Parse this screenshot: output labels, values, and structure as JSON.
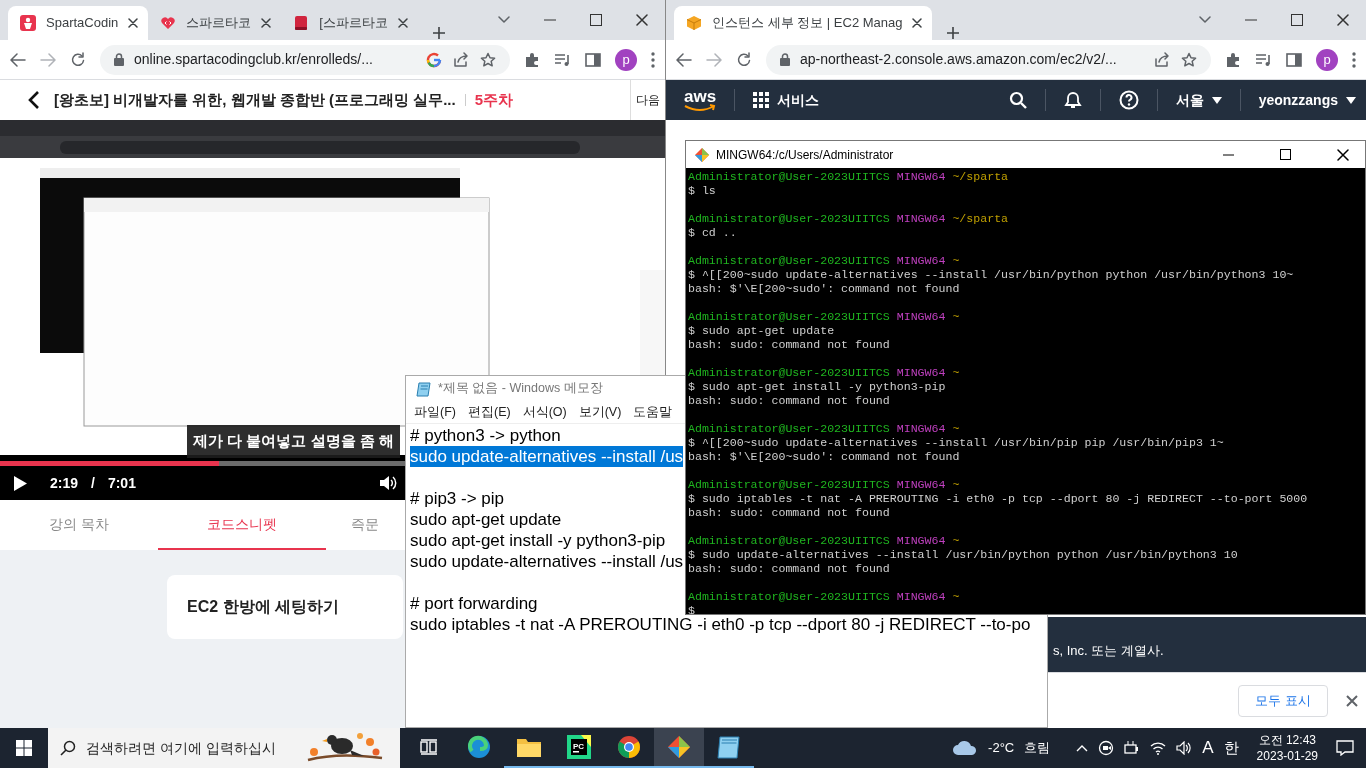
{
  "left_browser": {
    "tabs": [
      {
        "title": "SpartaCodin",
        "selected": true
      },
      {
        "title": "스파르타코",
        "selected": false
      },
      {
        "title": "[스파르타코",
        "selected": false
      }
    ],
    "address": "online.spartacodingclub.kr/enrolleds/...",
    "profile": "p",
    "course_title": "[왕초보] 비개발자를 위한, 웹개발 종합반 (프로그래밍 실무...",
    "week": "5주차",
    "next": "다음",
    "video": {
      "kind": "picture",
      "caption": "제가 다 붙여넣고 설명을 좀 해",
      "level": 0.33,
      "current": "2:19",
      "separator": "/",
      "duration": "7:01"
    },
    "lesson_tabs": [
      {
        "label": "강의 목차",
        "selected": false
      },
      {
        "label": "코드스니펫",
        "selected": true
      },
      {
        "label": "즉문",
        "selected": false
      }
    ],
    "snippet_card": "EC2 한방에 세팅하기"
  },
  "right_browser": {
    "tabs": [
      {
        "title": "인스턴스 세부 정보 | EC2 Manag",
        "selected": true
      }
    ],
    "address": "ap-northeast-2.console.aws.amazon.com/ec2/v2/...",
    "profile": "p",
    "aws_nav": {
      "logo": "aws",
      "services": "서비스",
      "region": "서울",
      "account": "yeonzzangs"
    },
    "footer": "s, Inc. 또는 계열사.",
    "download_bar": {
      "show_all": "모두 표시"
    }
  },
  "terminal": {
    "title": "MINGW64:/c/Users/Administrator",
    "lines": [
      {
        "kind": "prompt",
        "user": "Administrator@User-2023UIITCS",
        "shell": "MINGW64",
        "path": "~/sparta"
      },
      {
        "kind": "input",
        "text": "$ ls"
      },
      {
        "kind": "blank"
      },
      {
        "kind": "prompt",
        "user": "Administrator@User-2023UIITCS",
        "shell": "MINGW64",
        "path": "~/sparta"
      },
      {
        "kind": "input",
        "text": "$ cd .."
      },
      {
        "kind": "blank"
      },
      {
        "kind": "prompt",
        "user": "Administrator@User-2023UIITCS",
        "shell": "MINGW64",
        "path": "~"
      },
      {
        "kind": "input",
        "text": "$ ^[[200~sudo update-alternatives --install /usr/bin/python python /usr/bin/python3 10~"
      },
      {
        "kind": "output",
        "text": "bash: $'\\E[200~sudo': command not found"
      },
      {
        "kind": "blank"
      },
      {
        "kind": "prompt",
        "user": "Administrator@User-2023UIITCS",
        "shell": "MINGW64",
        "path": "~"
      },
      {
        "kind": "input",
        "text": "$ sudo apt-get update"
      },
      {
        "kind": "output",
        "text": "bash: sudo: command not found"
      },
      {
        "kind": "blank"
      },
      {
        "kind": "prompt",
        "user": "Administrator@User-2023UIITCS",
        "shell": "MINGW64",
        "path": "~"
      },
      {
        "kind": "input",
        "text": "$ sudo apt-get install -y python3-pip"
      },
      {
        "kind": "output",
        "text": "bash: sudo: command not found"
      },
      {
        "kind": "blank"
      },
      {
        "kind": "prompt",
        "user": "Administrator@User-2023UIITCS",
        "shell": "MINGW64",
        "path": "~"
      },
      {
        "kind": "input",
        "text": "$ ^[[200~sudo update-alternatives --install /usr/bin/pip pip /usr/bin/pip3 1~"
      },
      {
        "kind": "output",
        "text": "bash: $'\\E[200~sudo': command not found"
      },
      {
        "kind": "blank"
      },
      {
        "kind": "prompt",
        "user": "Administrator@User-2023UIITCS",
        "shell": "MINGW64",
        "path": "~"
      },
      {
        "kind": "input",
        "text": "$ sudo iptables -t nat -A PREROUTING -i eth0 -p tcp --dport 80 -j REDIRECT --to-port 5000"
      },
      {
        "kind": "output",
        "text": "bash: sudo: command not found"
      },
      {
        "kind": "blank"
      },
      {
        "kind": "prompt",
        "user": "Administrator@User-2023UIITCS",
        "shell": "MINGW64",
        "path": "~"
      },
      {
        "kind": "input",
        "text": "$ sudo update-alternatives --install /usr/bin/python python /usr/bin/python3 10"
      },
      {
        "kind": "output",
        "text": "bash: sudo: command not found"
      },
      {
        "kind": "blank"
      },
      {
        "kind": "prompt",
        "user": "Administrator@User-2023UIITCS",
        "shell": "MINGW64",
        "path": "~"
      },
      {
        "kind": "input",
        "text": "$"
      }
    ]
  },
  "notepad": {
    "title": "*제목 없음 - Windows 메모장",
    "menu": [
      "파일(F)",
      "편집(E)",
      "서식(O)",
      "보기(V)",
      "도움말"
    ],
    "lines": [
      {
        "text": "# python3 -> python",
        "selected": false
      },
      {
        "text": "sudo update-alternatives --install /us",
        "selected": true
      },
      {
        "selected": false
      },
      {
        "text": "# pip3 -> pip",
        "selected": false
      },
      {
        "text": "sudo apt-get update",
        "selected": false
      },
      {
        "text": "sudo apt-get install -y python3-pip",
        "selected": false
      },
      {
        "text": "sudo update-alternatives --install /us",
        "selected": false
      },
      {
        "selected": false
      },
      {
        "text": "# port forwarding",
        "selected": false
      },
      {
        "text": "sudo iptables -t nat -A PREROUTING -i eth0 -p tcp --dport 80 -j REDIRECT --to-po",
        "selected": false
      }
    ]
  },
  "taskbar": {
    "search_placeholder": "검색하려면 여기에 입력하십시",
    "apps": [
      {
        "kind": "edge",
        "running": false,
        "selected": false
      },
      {
        "kind": "explorer",
        "running": true,
        "selected": false
      },
      {
        "kind": "pycharm",
        "icon_text": "PC",
        "running": true,
        "selected": false
      },
      {
        "kind": "chrome",
        "running": true,
        "selected": false
      },
      {
        "kind": "git",
        "running": true,
        "selected": true
      },
      {
        "kind": "notepad",
        "running": true,
        "selected": false
      }
    ],
    "weather": {
      "temperature": "-2°C",
      "condition": "흐림"
    },
    "ime_mode": "A",
    "ime_lang": "한",
    "time": "오전 12:43",
    "date": "2023-01-29"
  }
}
